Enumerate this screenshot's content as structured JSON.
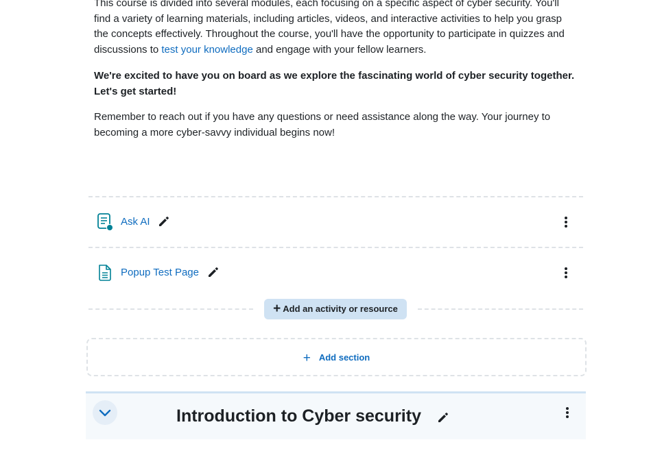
{
  "summary": {
    "para1_text_a": "This course is divided into several modules, each focusing on a specific aspect of cyber security. You'll find a variety of learning materials, including articles, videos, and interactive activities to help you grasp the concepts effectively. Throughout the course, you'll have the opportunity to participate in quizzes and discussions to ",
    "para1_link": "test your knowledge",
    "para1_text_b": " and engage with your fellow learners.",
    "para2_bold": "We're excited to have you on board as we explore the fascinating world of cyber security together. Let's get started!",
    "para3": "Remember to reach out if you have any questions or need assistance along the way. Your journey to becoming a more cyber-savvy individual begins now!"
  },
  "activities": [
    {
      "name": "Ask AI",
      "icon": "page-ai-icon"
    },
    {
      "name": "Popup Test Page",
      "icon": "page-icon"
    }
  ],
  "add_activity_label": "Add an activity or resource",
  "add_section_label": "Add section",
  "section": {
    "title": "Introduction to Cyber security"
  },
  "colors": {
    "link": "#0f6cbf",
    "page_icon": "#008196",
    "accent_bg": "#cfe2f3"
  }
}
